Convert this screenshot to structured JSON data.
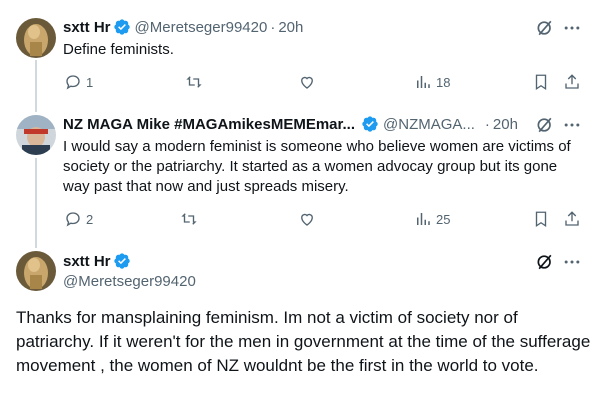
{
  "tweets": [
    {
      "name": "sxtt Hr",
      "handle": "@Meretseger99420",
      "time": "20h",
      "text": "Define feminists.",
      "replies": "1",
      "retweets": "",
      "likes": "",
      "views": "18"
    },
    {
      "name": "NZ MAGA Mike #MAGAmikesMEMEmar...",
      "handle": "@NZMAGA...",
      "time": "20h",
      "text": "I would say a modern feminist is someone who believe women are victims of society or the patriarchy. It started as a women advocay group but its gone way past that now and just spreads misery.",
      "replies": "2",
      "retweets": "",
      "likes": "",
      "views": "25"
    }
  ],
  "main_tweet": {
    "name": "sxtt Hr",
    "handle": "@Meretseger99420",
    "text": "Thanks for mansplaining feminism.  Im not a victim of society nor of patriarchy.  If it weren't for the men in government  at the time of the sufferage movement ,  the women of NZ wouldnt be the first in the world to vote."
  },
  "colors": {
    "verified": "#1d9bf0",
    "muted": "#536471",
    "text": "#0f1419"
  },
  "icons": [
    "verified-badge-icon",
    "grok-icon",
    "more-icon",
    "reply-icon",
    "retweet-icon",
    "like-icon",
    "views-icon",
    "bookmark-icon",
    "share-icon"
  ]
}
